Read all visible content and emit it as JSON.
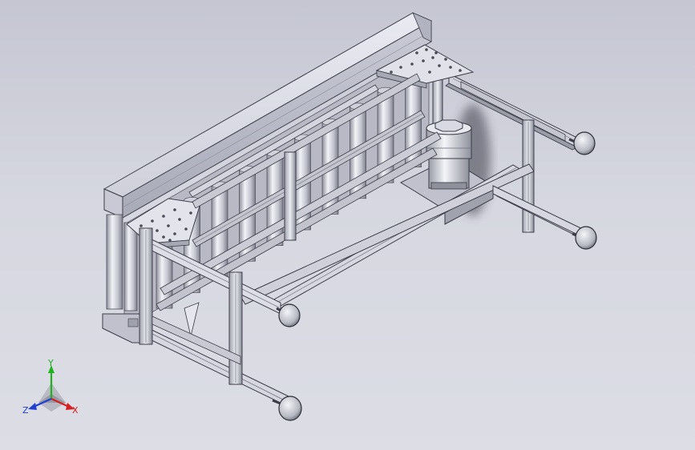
{
  "viewport": {
    "background_top": "#c5c6d2",
    "background_bottom": "#dcdde5",
    "model": "roller-conveyor-assembly"
  },
  "triad": {
    "x_label": "X",
    "y_label": "Y",
    "z_label": "Z",
    "x_color": "#d42020",
    "y_color": "#20b020",
    "z_color": "#2040d0"
  }
}
